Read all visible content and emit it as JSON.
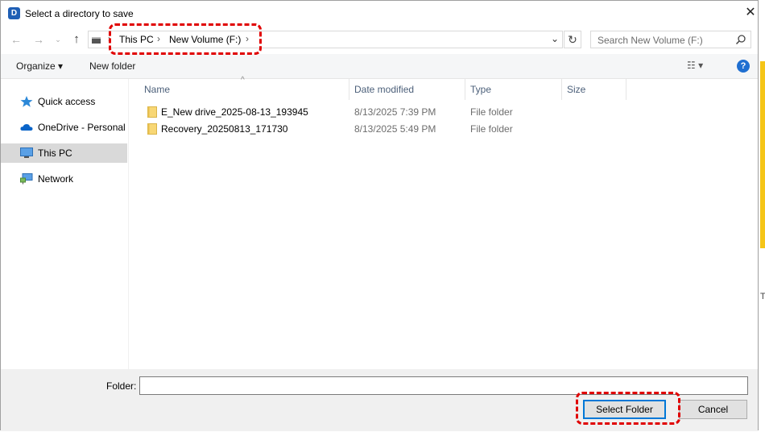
{
  "window": {
    "title": "Select a directory to save",
    "app_icon_letter": "D",
    "close_symbol": "✕"
  },
  "nav": {
    "back_icon": "←",
    "forward_icon": "→",
    "recent_icon": "⌄",
    "up_icon": "↑",
    "breadcrumb": [
      "This PC",
      "New Volume (F:)"
    ],
    "separator": "›",
    "dropdown_icon": "⌄",
    "refresh_icon": "↻"
  },
  "search": {
    "placeholder": "Search New Volume (F:)"
  },
  "toolbar": {
    "organize": "Organize ▾",
    "new_folder": "New folder",
    "view_icon": "☷ ▾",
    "help_icon": "?"
  },
  "sidebar": {
    "items": [
      {
        "label": "Quick access",
        "icon": "star-icon"
      },
      {
        "label": "OneDrive - Personal",
        "icon": "cloud-icon"
      },
      {
        "label": "This PC",
        "icon": "monitor-icon",
        "selected": true
      },
      {
        "label": "Network",
        "icon": "network-icon"
      }
    ]
  },
  "files": {
    "sort_icon": "^",
    "columns": [
      "Name",
      "Date modified",
      "Type",
      "Size"
    ],
    "rows": [
      {
        "name": "E_New drive_2025-08-13_193945",
        "date": "8/13/2025 7:39 PM",
        "type": "File folder"
      },
      {
        "name": "Recovery_20250813_171730",
        "date": "8/13/2025 5:49 PM",
        "type": "File folder"
      }
    ]
  },
  "footer": {
    "folder_label": "Folder:",
    "folder_value": "",
    "select_button": "Select Folder",
    "cancel_button": "Cancel"
  },
  "background_peek": {
    "char": "T"
  },
  "colors": {
    "accent": "#0078d7",
    "annotation": "#e00000",
    "folder": "#f8d775",
    "selection": "#d9d9d9"
  }
}
